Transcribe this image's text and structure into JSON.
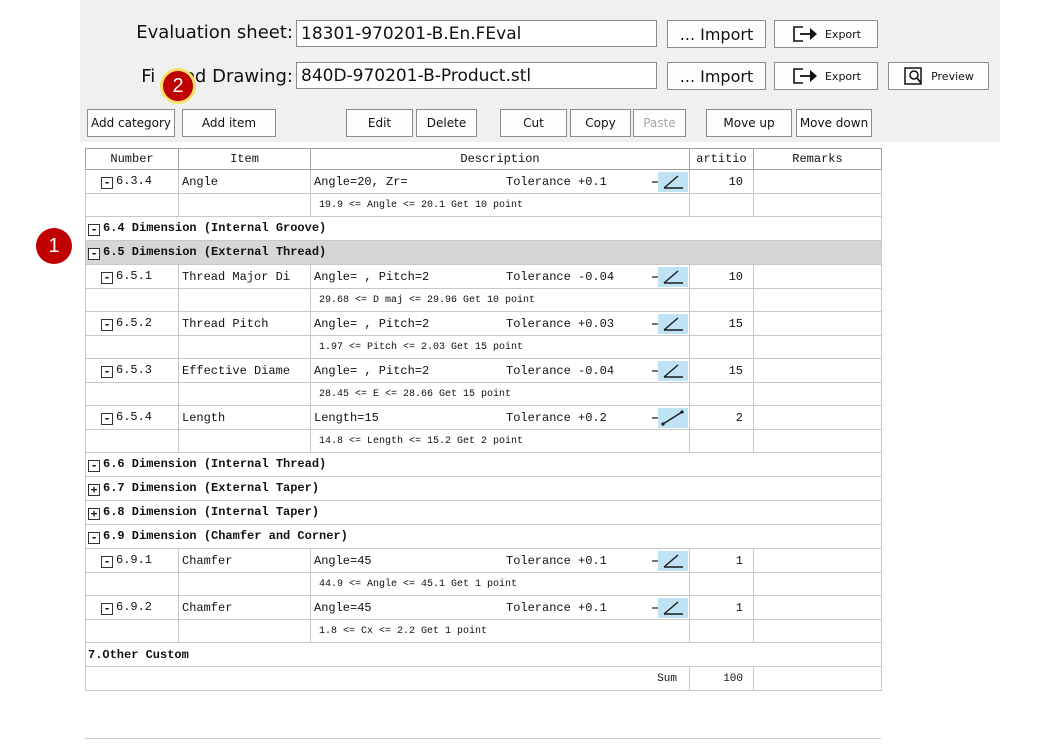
{
  "header": {
    "eval_label": "Evaluation sheet:",
    "eval_value": "18301-970201-B.En.FEval",
    "drawing_label": "Fi     ed Drawing:",
    "drawing_value": "840D-970201-B-Product.stl",
    "import_label": "... Import",
    "export_label": "Export",
    "preview_label": "Preview"
  },
  "toolbar": {
    "add_category": "Add category",
    "add_item": "Add item",
    "edit": "Edit",
    "delete": "Delete",
    "cut": "Cut",
    "copy": "Copy",
    "paste": "Paste",
    "move_up": "Move up",
    "move_down": "Move down"
  },
  "table": {
    "columns": [
      "Number",
      "Item",
      "Description",
      "artitio",
      "Remarks"
    ],
    "rows": [
      {
        "kind": "item",
        "toggle": "-",
        "number": "6.3.4",
        "item": "Angle",
        "desc": "Angle=20, Zr=",
        "tol": "Tolerance +0.1",
        "icon": "angle-icon",
        "points": "10",
        "remark": ""
      },
      {
        "kind": "sub",
        "text": "19.9 <= Angle <= 20.1 Get 10 point"
      },
      {
        "kind": "cat",
        "toggle": "-",
        "text": "6.4 Dimension (Internal Groove)"
      },
      {
        "kind": "cat",
        "toggle": "-",
        "text": "6.5 Dimension (External Thread)",
        "selected": true
      },
      {
        "kind": "item",
        "toggle": "-",
        "number": "6.5.1",
        "item": "Thread Major Di",
        "desc": "Angle= , Pitch=2",
        "tol": "Tolerance -0.04",
        "icon": "angle-icon",
        "points": "10",
        "remark": ""
      },
      {
        "kind": "sub",
        "text": "29.68 <= D maj <= 29.96 Get 10 point"
      },
      {
        "kind": "item",
        "toggle": "-",
        "number": "6.5.2",
        "item": "Thread Pitch",
        "desc": "Angle= , Pitch=2",
        "tol": "Tolerance +0.03",
        "icon": "angle-icon",
        "points": "15",
        "remark": ""
      },
      {
        "kind": "sub",
        "text": "1.97 <= Pitch <= 2.03 Get 15 point"
      },
      {
        "kind": "item",
        "toggle": "-",
        "number": "6.5.3",
        "item": "Effective Diame",
        "desc": "Angle= , Pitch=2",
        "tol": "Tolerance -0.04",
        "icon": "angle-icon",
        "points": "15",
        "remark": ""
      },
      {
        "kind": "sub",
        "text": "28.45 <= E <= 28.66 Get 15 point"
      },
      {
        "kind": "item",
        "toggle": "-",
        "number": "6.5.4",
        "item": "Length",
        "desc": "Length=15",
        "tol": "Tolerance +0.2",
        "icon": "length-icon",
        "points": "2",
        "remark": ""
      },
      {
        "kind": "sub",
        "text": "14.8 <= Length <= 15.2 Get 2 point"
      },
      {
        "kind": "cat",
        "toggle": "-",
        "text": "6.6 Dimension (Internal Thread)"
      },
      {
        "kind": "cat",
        "toggle": "+",
        "text": "6.7 Dimension (External Taper)"
      },
      {
        "kind": "cat",
        "toggle": "+",
        "text": "6.8 Dimension (Internal Taper)"
      },
      {
        "kind": "cat",
        "toggle": "-",
        "text": "6.9 Dimension (Chamfer and Corner)"
      },
      {
        "kind": "item",
        "toggle": "-",
        "number": "6.9.1",
        "item": "Chamfer",
        "desc": "Angle=45",
        "tol": "Tolerance +0.1",
        "icon": "angle-icon",
        "points": "1",
        "remark": ""
      },
      {
        "kind": "sub",
        "text": "44.9 <= Angle <= 45.1 Get 1 point"
      },
      {
        "kind": "item",
        "toggle": "-",
        "number": "6.9.2",
        "item": "Chamfer",
        "desc": "Angle=45",
        "tol": "Tolerance +0.1",
        "icon": "angle-icon",
        "points": "1",
        "remark": ""
      },
      {
        "kind": "sub",
        "text": "1.8 <= Cx <= 2.2 Get 1 point"
      },
      {
        "kind": "cat",
        "toggle": "",
        "text": "7.Other Custom"
      },
      {
        "kind": "sum",
        "label": "Sum",
        "value": "100"
      }
    ]
  },
  "badges": {
    "one": "1",
    "two": "2"
  },
  "colors": {
    "badge": "#c00000",
    "badge_ring": "#f6e26a",
    "selected_row": "#d6d6d6",
    "icon_bg": "#bfe3f5"
  }
}
